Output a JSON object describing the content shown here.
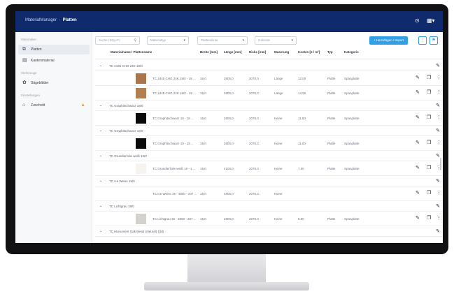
{
  "header": {
    "app_name": "MaterialManager",
    "section": "Platten",
    "help_icon": "help-circle-icon",
    "user_icon": "user-menu-icon"
  },
  "sidebar": {
    "sections": [
      {
        "label": "Materialien",
        "items": [
          {
            "label": "Platten",
            "icon": "layers-icon",
            "active": true
          },
          {
            "label": "Kantenmaterial",
            "icon": "edge-icon",
            "active": false
          }
        ]
      },
      {
        "label": "Werkzeuge",
        "items": [
          {
            "label": "Sägeblätter",
            "icon": "gear-icon",
            "active": false
          }
        ]
      },
      {
        "label": "Einstellungen",
        "items": [
          {
            "label": "Zuschnitt",
            "icon": "home-icon",
            "active": false,
            "warning": true
          }
        ]
      }
    ]
  },
  "toolbar": {
    "search_placeholder": "Suche (Strg+F)",
    "filter1": "Materialtyp",
    "filter2": "Plattendicke",
    "filter3": "Gebinde",
    "new_button": "+ Hinzufügen / Import",
    "colors": {
      "primary": "#2fa0e6",
      "header": "#0f2b6e"
    }
  },
  "table": {
    "columns": [
      "Materialname / Plattenname",
      "Breite [mm]",
      "Länge [mm]",
      "Dicke [mm]",
      "Maserung",
      "Kosten [€ / m²]",
      "Typ",
      "Kategorie"
    ],
    "groups": [
      {
        "label": "TC 2445 CHG 24K 18/0",
        "items": [
          {
            "name": "TC 2445 CHG 24K 18/0 - 18 ...",
            "width": "18,0",
            "length": "2800,0",
            "thickness": "2070,0",
            "grain": "Länge",
            "cost": "12,00",
            "type": "Platte",
            "category": "Spanplatte",
            "swatch": "#a8764a"
          },
          {
            "name": "TC 2445 CHG 24K 18/0 - 19 ...",
            "width": "19,0",
            "length": "2800,0",
            "thickness": "2070,0",
            "grain": "Länge",
            "cost": "14,50",
            "type": "Platte",
            "category": "Spanplatte",
            "swatch": "#b07f52"
          }
        ]
      },
      {
        "label": "TC Graphitschwarz 18/0",
        "items": [
          {
            "name": "TC Graphitschwarz 18 - 18 ...",
            "width": "18,0",
            "length": "2800,0",
            "thickness": "2070,0",
            "grain": "Keine",
            "cost": "11,50",
            "type": "Platte",
            "category": "Spanplatte",
            "swatch": "#0a0a0a"
          }
        ]
      },
      {
        "label": "TC Graphitschwarz 19/0",
        "items": [
          {
            "name": "TC Graphitschwarz 19 - 19 ...",
            "width": "19,0",
            "length": "2800,0",
            "thickness": "2070,0",
            "grain": "Keine",
            "cost": "11,00",
            "type": "Platte",
            "category": "Spanplatte",
            "swatch": "#0a0a0a"
          }
        ]
      },
      {
        "label": "TC Grundierfolie weiß 19/0",
        "items": [
          {
            "name": "TC Grundierfolie weiß 19 - 1 ...",
            "width": "19,0",
            "length": "4100,0",
            "thickness": "2070,0",
            "grain": "Keine",
            "cost": "7,00",
            "type": "Platte",
            "category": "Spanplatte",
            "swatch": "#f5f4f0"
          }
        ]
      },
      {
        "label": "TC Ice Weiss 19/0",
        "items": [
          {
            "name": "TC Ice Weiss 19 - 4800 - 207 ...",
            "width": "19,0",
            "length": "4800,0",
            "thickness": "2070,0",
            "grain": "Keine",
            "cost": "",
            "type": "",
            "category": "",
            "swatch": "#ffffff"
          }
        ]
      },
      {
        "label": "TC Lichtgrau 19/0",
        "items": [
          {
            "name": "TC Lichtgrau 19 - 2800 - 207 ...",
            "width": "19,0",
            "length": "2800,0",
            "thickness": "2070,0",
            "grain": "Keine",
            "cost": "8,00",
            "type": "Platte",
            "category": "Spanplatte",
            "swatch": "#d3d2cc"
          }
        ]
      },
      {
        "label": "TC Monument Oak Metal (natural) 19/0",
        "items": []
      }
    ]
  }
}
